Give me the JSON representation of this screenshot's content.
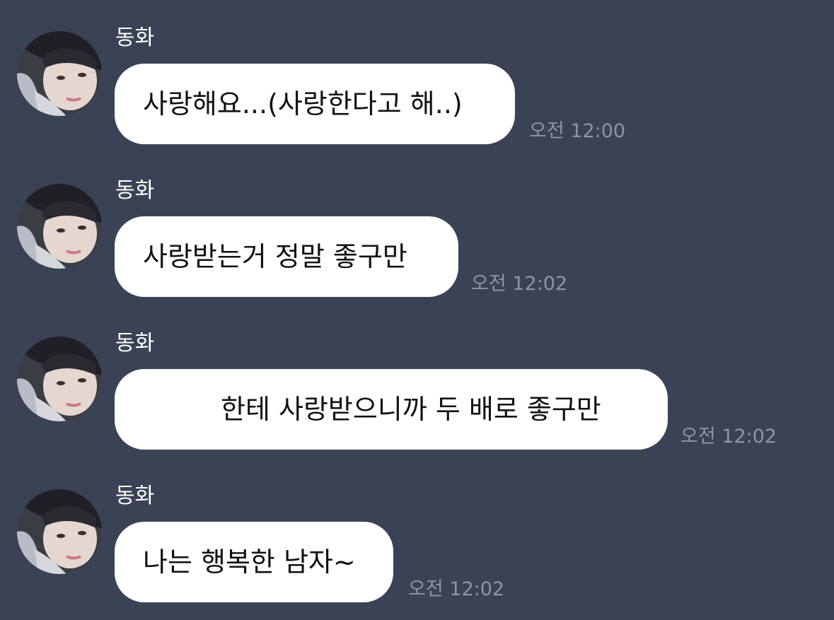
{
  "messages": [
    {
      "sender": "동화",
      "text": "사랑해요...(사랑한다고 해..)",
      "time": "오전 12:00"
    },
    {
      "sender": "동화",
      "text": "사랑받는거 정말 좋구만",
      "time": "오전 12:02"
    },
    {
      "sender": "동화",
      "text": "한테 사랑받으니까 두 배로 좋구만",
      "time": "오전 12:02"
    },
    {
      "sender": "동화",
      "text": "나는 행복한 남자~",
      "time": "오전 12:02"
    }
  ],
  "colors": {
    "background": "#3a4256",
    "bubble": "#ffffff",
    "bubble_text": "#111111",
    "sender_text": "#ffffff",
    "time_text": "#8d94a3"
  },
  "icons": {
    "avatar": "profile-photo-avatar"
  }
}
